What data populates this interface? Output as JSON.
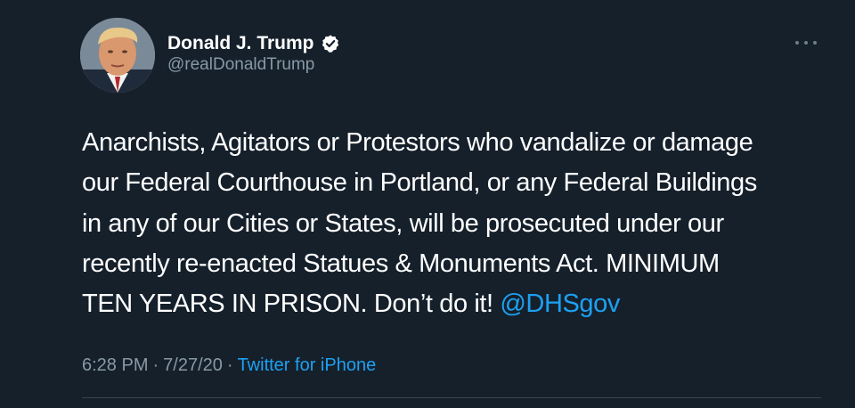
{
  "tweet": {
    "author": {
      "display_name": "Donald J. Trump",
      "handle": "@realDonaldTrump",
      "verified": true
    },
    "text_lines": [
      "Anarchists, Agitators or Protestors who vandalize or damage",
      "our Federal Courthouse in Portland, or any Federal Buildings",
      "in any of our Cities or States, will be prosecuted under our",
      "recently re-enacted Statues & Monuments Act. MINIMUM",
      "TEN YEARS IN PRISON. Don’t do it! "
    ],
    "mention": "@DHSgov",
    "time": "6:28 PM",
    "separator": "·",
    "date": "7/27/20",
    "source": "Twitter for iPhone"
  },
  "colors": {
    "background": "#15202b",
    "accent": "#1da1f2",
    "secondary_text": "#8899a6"
  },
  "icons": {
    "verified": "verified-badge-icon",
    "more": "more-options-icon"
  }
}
